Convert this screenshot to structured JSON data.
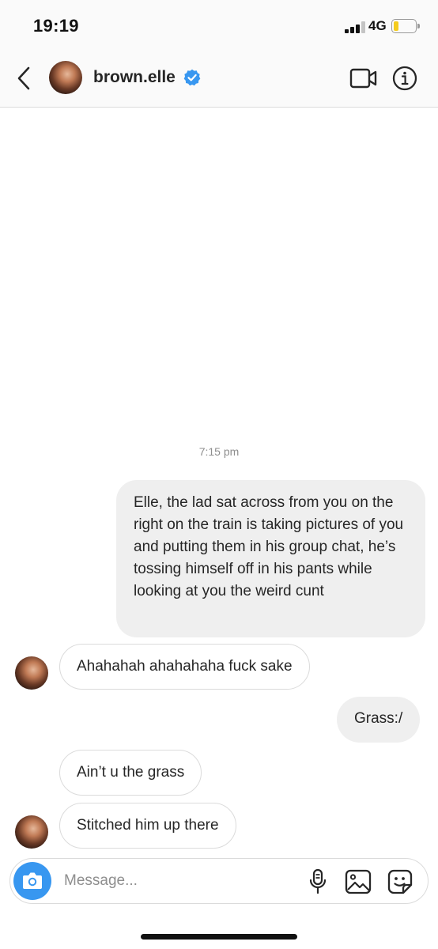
{
  "status_bar": {
    "time": "19:19",
    "network": "4G",
    "signal_bars_filled": 3,
    "signal_bars_total": 4,
    "battery_level": 0.25,
    "battery_color": "#f5cc1d"
  },
  "header": {
    "username": "brown.elle",
    "verified": true,
    "verified_color": "#3897f0",
    "icons": [
      "back-chevron-icon",
      "video-call-icon",
      "info-icon"
    ]
  },
  "thread": {
    "timestamp": "7:15 pm",
    "messages": [
      {
        "direction": "outgoing",
        "text": "Elle, the lad sat across from you on the right on the train is taking pictures of you and putting them in his group chat, he’s tossing himself off in his pants while looking at you the weird cunt"
      },
      {
        "direction": "incoming",
        "text": "Ahahahah ahahahaha fuck sake"
      },
      {
        "direction": "outgoing",
        "text": "Grass:/"
      },
      {
        "direction": "incoming",
        "text": "Ain’t u the grass"
      },
      {
        "direction": "incoming",
        "text": "Stitched him up there"
      }
    ]
  },
  "composer": {
    "placeholder": "Message...",
    "value": "",
    "icons": [
      "camera-icon",
      "microphone-icon",
      "gallery-icon",
      "sticker-icon"
    ],
    "accent_color": "#3897f0"
  },
  "colors": {
    "outgoing_bubble": "#efefef",
    "incoming_border": "#dbdbdb",
    "text": "#262626",
    "muted": "#8e8e8e"
  }
}
